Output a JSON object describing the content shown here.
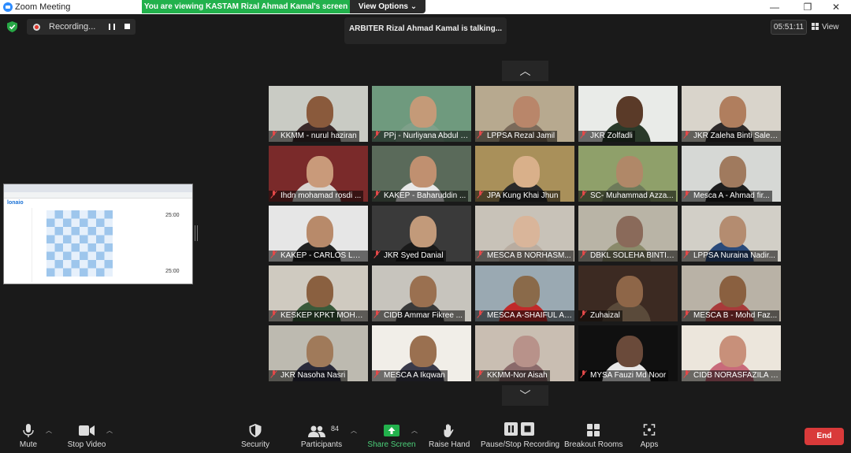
{
  "window": {
    "title": "Zoom Meeting",
    "minimize": "—",
    "restore": "❐",
    "close": "✕"
  },
  "share_banner": {
    "text": "You are viewing KASTAM Rizal Ahmad Kamal's screen",
    "view_options": "View Options ⌄"
  },
  "recording": {
    "label": "Recording..."
  },
  "speaker": {
    "text": "ARBITER Rizal Ahmad Kamal is talking..."
  },
  "timer": "05:51:11",
  "view_label": "View",
  "shared_screen": {
    "logo": "lonaio",
    "clock_top": "25:00",
    "clock_bottom": "25:00"
  },
  "participants": [
    {
      "name": "KKMM - nurul haziran",
      "bg": "#c9cbc4",
      "skin": "#8a5a3c",
      "cloth": "#3b2a2a"
    },
    {
      "name": "PPj - Nurliyana Abdul Ra...",
      "bg": "#6f9a7e",
      "skin": "#c49a78",
      "cloth": "#7fa08a"
    },
    {
      "name": "LPPSA Rezal Jamil",
      "bg": "#b7a98f",
      "skin": "#b9866a",
      "cloth": "#7a6a5a"
    },
    {
      "name": "JKR Zolfadli",
      "bg": "#e9ebe8",
      "skin": "#5a3a28",
      "cloth": "#2a3a2a"
    },
    {
      "name": "JKR Zaleha Binti Salehod...",
      "bg": "#d9d4cb",
      "skin": "#b07e5e",
      "cloth": "#2e2a2a"
    },
    {
      "name": "Ihdn mohamad rosdi ...",
      "bg": "#7a2a2a",
      "skin": "#c99a7a",
      "cloth": "#d8d4d0"
    },
    {
      "name": "KAKEP - Baharuddin ...",
      "bg": "#5a6a5a",
      "skin": "#c09070",
      "cloth": "#e8e8e8"
    },
    {
      "name": "JPA Kung Khai Jhun",
      "bg": "#a9905a",
      "skin": "#d9b08a",
      "cloth": "#2a2a2a"
    },
    {
      "name": "SC- Muhammad Azza...",
      "bg": "#8fa06a",
      "skin": "#b08868",
      "cloth": "#6e7a5a"
    },
    {
      "name": "Mesca A - Ahmad fir...",
      "bg": "#d6d8d5",
      "skin": "#a07a5e",
      "cloth": "#1e1e1e"
    },
    {
      "name": "KAKEP - CARLOS LOY...",
      "bg": "#e6e6e6",
      "skin": "#b88a6a",
      "cloth": "#222222"
    },
    {
      "name": "JKR Syed Danial",
      "bg": "#3a3a3a",
      "skin": "#c29a7a",
      "cloth": "#1a1a1a"
    },
    {
      "name": "MESCA B NORHASM...",
      "bg": "#c8c2b8",
      "skin": "#d9b59a",
      "cloth": "#b8aca0"
    },
    {
      "name": "DBKL SOLEHA BINTI HA...",
      "bg": "#b9b4a6",
      "skin": "#8a6a5a",
      "cloth": "#8a8a6a"
    },
    {
      "name": "LPPSA Nuraina Nadir...",
      "bg": "#d2cfc7",
      "skin": "#b48c70",
      "cloth": "#2a4a7a"
    },
    {
      "name": "KESKEP KPKT MOHD ...",
      "bg": "#cfcac0",
      "skin": "#8a6040",
      "cloth": "#3a5a3a"
    },
    {
      "name": "CIDB Ammar Fikree ...",
      "bg": "#c7c4bd",
      "skin": "#9a7050",
      "cloth": "#3a3a3a"
    },
    {
      "name": "MESCA A-SHAIFUL Al...",
      "bg": "#9aa9b2",
      "skin": "#8a6a4a",
      "cloth": "#c02a2a"
    },
    {
      "name": "Zuhaizal",
      "bg": "#3c2a22",
      "skin": "#8e6648",
      "cloth": "#5a4a3a"
    },
    {
      "name": "MESCA B - Mohd Faz...",
      "bg": "#b9b2a6",
      "skin": "#8a6040",
      "cloth": "#a83a3a"
    },
    {
      "name": "JKR Nasoha Nasri",
      "bg": "#bdbab0",
      "skin": "#a07a5a",
      "cloth": "#2a2a3a"
    },
    {
      "name": "MESCA A Ikqwan",
      "bg": "#f1eee8",
      "skin": "#9a7050",
      "cloth": "#3a3a4a"
    },
    {
      "name": "KKMM-Nor Aisah",
      "bg": "#c9beb2",
      "skin": "#b8928a",
      "cloth": "#8a6a6a"
    },
    {
      "name": "MYSA Fauzi Md Noor",
      "bg": "#101010",
      "skin": "#6a4a3a",
      "cloth": "#e8e8e8"
    },
    {
      "name": "CIDB NORASFAZILA BI...",
      "bg": "#ece6dc",
      "skin": "#c8907a",
      "cloth": "#c86a7a"
    }
  ],
  "toolbar": {
    "mute": "Mute",
    "stop_video": "Stop Video",
    "security": "Security",
    "participants": "Participants",
    "participants_count": "84",
    "share_screen": "Share Screen",
    "raise_hand": "Raise Hand",
    "pause_stop_recording": "Pause/Stop Recording",
    "breakout_rooms": "Breakout Rooms",
    "apps": "Apps",
    "end": "End"
  },
  "colors": {
    "share_green": "#22b14c",
    "end_red": "#d93a3a",
    "mute_red": "#e34949"
  }
}
